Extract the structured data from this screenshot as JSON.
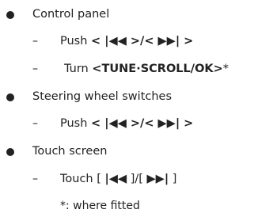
{
  "sections": [
    {
      "heading": "Control panel",
      "sub": [
        {
          "pre": "Push ",
          "bold": "< |◀◀ >/< ▶▶| >",
          "post": ""
        },
        {
          "pre": "Turn ",
          "bold": "<TUNE·SCROLL/OK>",
          "post": "*"
        }
      ]
    },
    {
      "heading": "Steering wheel switches",
      "sub": [
        {
          "pre": "Push ",
          "bold": "< |◀◀ >/< ▶▶| >",
          "post": ""
        }
      ]
    },
    {
      "heading": "Touch screen",
      "sub": [
        {
          "pre": "Touch [ ",
          "bold": "|◀◀",
          "mid": " ]/[ ",
          "bold2": "▶▶|",
          "post": " ]"
        }
      ]
    }
  ],
  "dash_char": "–",
  "footnote": "*: where fitted"
}
